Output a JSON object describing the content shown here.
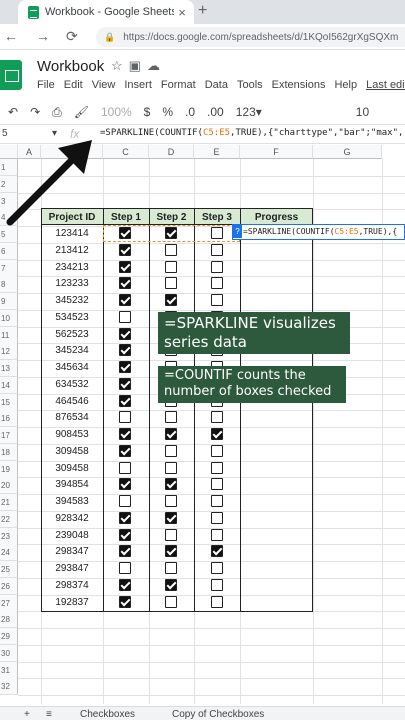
{
  "browser": {
    "tab_title": "Workbook - Google Sheets",
    "close": "×",
    "new_tab": "+",
    "url": "https://docs.google.com/spreadsheets/d/1KQoI562grXgSQXm"
  },
  "sheet": {
    "title": "Workbook",
    "menu": [
      "File",
      "Edit",
      "View",
      "Insert",
      "Format",
      "Data",
      "Tools",
      "Extensions",
      "Help",
      "Last edit"
    ],
    "toolbar": {
      "zoom": "100%",
      "currency": "$",
      "percent": "%",
      "dec_less": ".0",
      "dec_more": ".00",
      "format_123": "123▾",
      "font_size": "10"
    },
    "name_box": "5",
    "fx": "fx",
    "formula_prefix": "=SPARKLINE(COUNTIF(",
    "formula_ref": "C5:E5",
    "formula_suffix": ",TRUE),{\"charttype\",\"bar\";\"max\","
  },
  "grid": {
    "columns": [
      "A",
      "B",
      "C",
      "D",
      "E",
      "F",
      "G"
    ],
    "rows": [
      "1",
      "2",
      "3",
      "4",
      "5",
      "6",
      "7",
      "8",
      "9",
      "10",
      "11",
      "12",
      "13",
      "14",
      "15",
      "16",
      "17",
      "18",
      "19",
      "20",
      "21",
      "22",
      "23",
      "24",
      "25",
      "26",
      "27",
      "28",
      "29",
      "30",
      "31",
      "32"
    ]
  },
  "table": {
    "headers": [
      "Project ID",
      "Step 1",
      "Step 2",
      "Step 3",
      "Progress"
    ],
    "rows": [
      {
        "id": "123414",
        "s1": true,
        "s2": true,
        "s3": false
      },
      {
        "id": "213412",
        "s1": true,
        "s2": false,
        "s3": false
      },
      {
        "id": "234213",
        "s1": true,
        "s2": false,
        "s3": false
      },
      {
        "id": "123233",
        "s1": true,
        "s2": false,
        "s3": false
      },
      {
        "id": "345232",
        "s1": true,
        "s2": true,
        "s3": false
      },
      {
        "id": "534523",
        "s1": false,
        "s2": false,
        "s3": false
      },
      {
        "id": "562523",
        "s1": true,
        "s2": false,
        "s3": false
      },
      {
        "id": "345234",
        "s1": true,
        "s2": false,
        "s3": false
      },
      {
        "id": "345634",
        "s1": true,
        "s2": false,
        "s3": false
      },
      {
        "id": "634532",
        "s1": true,
        "s2": false,
        "s3": false
      },
      {
        "id": "464546",
        "s1": true,
        "s2": false,
        "s3": false
      },
      {
        "id": "876534",
        "s1": false,
        "s2": false,
        "s3": false
      },
      {
        "id": "908453",
        "s1": true,
        "s2": true,
        "s3": true
      },
      {
        "id": "309458",
        "s1": true,
        "s2": false,
        "s3": false
      },
      {
        "id": "309458",
        "s1": false,
        "s2": false,
        "s3": false
      },
      {
        "id": "394854",
        "s1": true,
        "s2": true,
        "s3": false
      },
      {
        "id": "394583",
        "s1": false,
        "s2": false,
        "s3": false
      },
      {
        "id": "928342",
        "s1": true,
        "s2": true,
        "s3": false
      },
      {
        "id": "239048",
        "s1": true,
        "s2": false,
        "s3": false
      },
      {
        "id": "298347",
        "s1": true,
        "s2": true,
        "s3": true
      },
      {
        "id": "293847",
        "s1": false,
        "s2": false,
        "s3": false
      },
      {
        "id": "298374",
        "s1": true,
        "s2": true,
        "s3": false
      },
      {
        "id": "192837",
        "s1": true,
        "s2": false,
        "s3": false
      }
    ]
  },
  "formula_popup": {
    "help": "?",
    "prefix": "=SPARKLINE(COUNTIF(",
    "ref": "C5:E5",
    "suffix": ",TRUE),{"
  },
  "callouts": {
    "sparkline": "=SPARKLINE visualizes series data",
    "countif": "=COUNTIF counts the number of boxes checked"
  },
  "bottom_tabs": [
    "+",
    "≡",
    "Checkboxes",
    "Copy of Checkboxes"
  ],
  "colors": {
    "header_green": "#d9ead3",
    "callout_green": "#2d5a3d",
    "sheets_green": "#0f9d58",
    "selection_blue": "#1a73e8"
  }
}
